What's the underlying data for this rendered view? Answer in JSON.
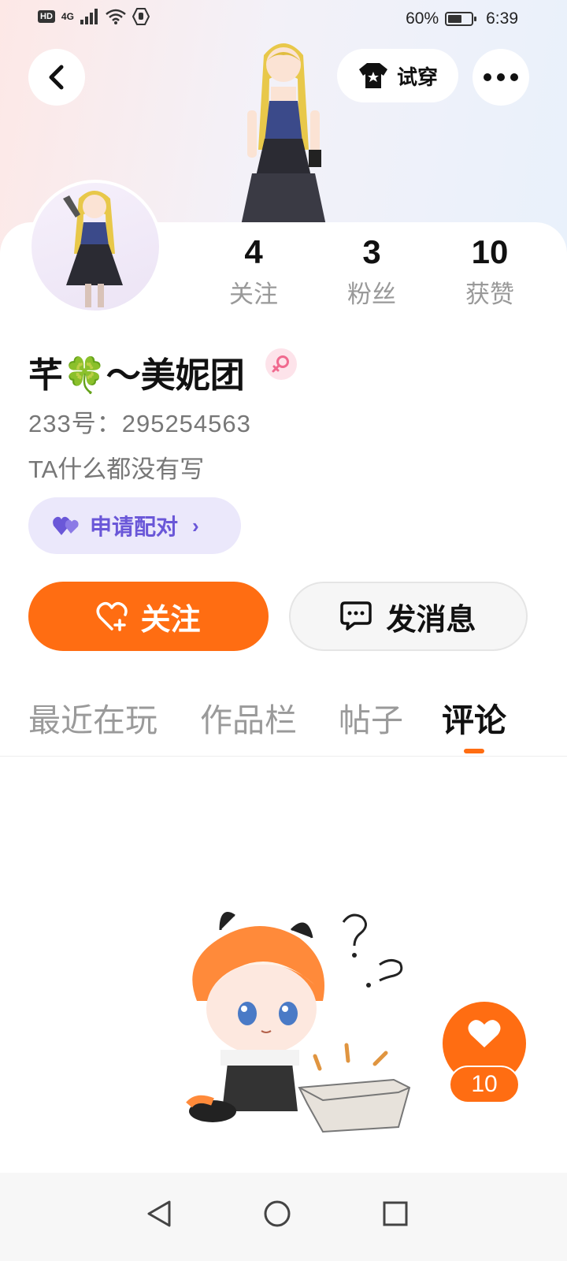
{
  "status_bar": {
    "network": "4G",
    "battery_percent": "60%",
    "battery_level": 0.6,
    "time": "6:39"
  },
  "header": {
    "back_icon": "chevron-left-icon",
    "try_on_label": "试穿",
    "more_icon": "ellipsis-icon"
  },
  "profile": {
    "nickname": "芊🍀～美妮团",
    "gender_icon": "female-icon",
    "account_id": "233号：295254563",
    "bio": "TA什么都没有写",
    "pair_label": "申请配对"
  },
  "stats": [
    {
      "value": "4",
      "label": "关注"
    },
    {
      "value": "3",
      "label": "粉丝"
    },
    {
      "value": "10",
      "label": "获赞"
    }
  ],
  "actions": {
    "follow_label": "关注",
    "message_label": "发消息"
  },
  "tabs": [
    {
      "label": "最近在玩"
    },
    {
      "label": "作品栏"
    },
    {
      "label": "帖子"
    },
    {
      "label": "评论"
    }
  ],
  "active_tab": "评论",
  "like_fab": {
    "count": "10"
  },
  "colors": {
    "accent": "#ff6d12",
    "pair_purple": "#6a57d8",
    "pair_bg": "#ebe8fb"
  }
}
